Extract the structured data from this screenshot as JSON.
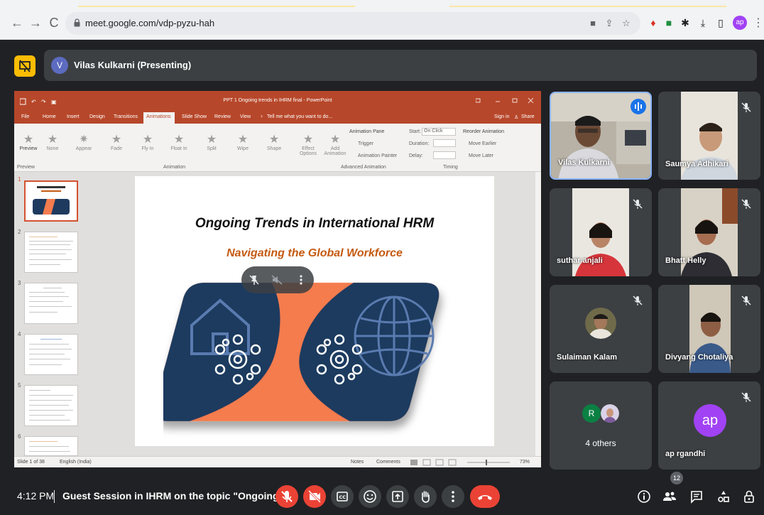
{
  "browser": {
    "url": "meet.google.com/vdp-pyzu-hah",
    "profile_initials": "ap"
  },
  "presenter": {
    "initial": "V",
    "label": "Vilas Kulkarni (Presenting)"
  },
  "powerpoint": {
    "window_title": "PPT 1 Ongoing trends in IHRM final - PowerPoint",
    "menu": [
      "File",
      "Home",
      "Insert",
      "Design",
      "Transitions",
      "Animations",
      "Slide Show",
      "Review",
      "View"
    ],
    "tell_me": "Tell me what you want to do...",
    "sign_in": "Sign in",
    "share": "Share",
    "animations": [
      "None",
      "Appear",
      "Fade",
      "Fly In",
      "Float In",
      "Split",
      "Wipe",
      "Shape"
    ],
    "preview_label": "Preview",
    "effect_options": "Effect Options",
    "add_animation": "Add Animation",
    "animation_pane": "Animation Pane",
    "trigger": "Trigger",
    "animation_painter": "Animation Painter",
    "start_label": "Start:",
    "start_value": "On Click",
    "duration_label": "Duration:",
    "delay_label": "Delay:",
    "reorder": "Reorder Animation",
    "move_earlier": "Move Earlier",
    "move_later": "Move Later",
    "groups": {
      "preview": "Preview",
      "animation": "Animation",
      "advanced": "Advanced Animation",
      "timing": "Timing"
    },
    "slide_numbers": [
      "1",
      "2",
      "3",
      "4",
      "5",
      "6"
    ],
    "slide_title": "Ongoing Trends in International HRM",
    "slide_subtitle": "Navigating the Global Workforce",
    "status": {
      "slide_counter": "Slide 1 of 38",
      "language": "English (India)",
      "notes": "Notes",
      "comments": "Comments",
      "zoom": "73%"
    }
  },
  "participants": [
    {
      "name": "Vilas Kulkarni",
      "speaking": true,
      "muted": false
    },
    {
      "name": "Saumya Adhikari",
      "muted": true
    },
    {
      "name": "suthar anjali",
      "muted": true
    },
    {
      "name": "Bhatt Helly",
      "muted": true
    },
    {
      "name": "Sulaiman Kalam",
      "muted": true
    },
    {
      "name": "Divyang Chotaliya",
      "muted": true
    },
    {
      "name": "4 others",
      "avatar_initial": "R"
    },
    {
      "name": "ap rgandhi",
      "avatar_initial": "ap",
      "muted": true
    }
  ],
  "bottom_bar": {
    "time": "4:12 PM",
    "meeting_title": "Guest Session in IHRM on the topic \"Ongoing tr...",
    "people_count": "12"
  },
  "colors": {
    "meet_bg": "#202124",
    "tile_bg": "#3c4043",
    "danger": "#ea4335",
    "ppt_orange": "#b7472a",
    "slide_navy": "#1f3a5f",
    "slide_orange": "#f47c4e"
  }
}
